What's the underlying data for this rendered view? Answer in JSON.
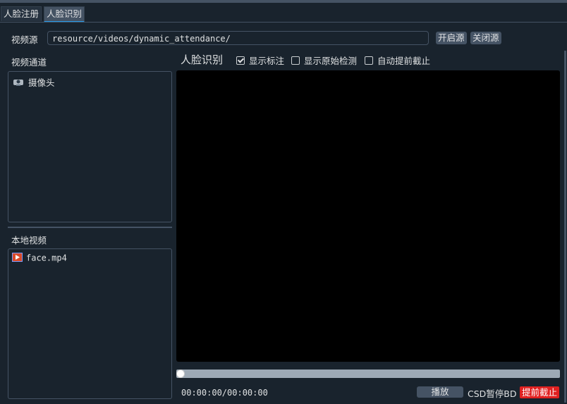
{
  "tabs": [
    {
      "label": "人脸注册",
      "active": false
    },
    {
      "label": "人脸识别",
      "active": true
    }
  ],
  "source": {
    "label": "视频源",
    "value": "resource/videos/dynamic_attendance/",
    "open_button": "开启源",
    "close_button": "关闭源"
  },
  "channels": {
    "title": "视频通道",
    "items": [
      {
        "label": "摄像头",
        "icon": "webcam-icon"
      }
    ]
  },
  "local_videos": {
    "title": "本地视频",
    "items": [
      {
        "label": "face.mp4",
        "icon": "video-file-icon"
      }
    ]
  },
  "recognition": {
    "title": "人脸识别",
    "options": [
      {
        "label": "显示标注",
        "checked": true
      },
      {
        "label": "显示原始检测",
        "checked": false
      },
      {
        "label": "自动提前截止",
        "checked": false
      }
    ]
  },
  "player": {
    "timecode": "00:00:00/00:00:00",
    "progress": 0,
    "play_button": "播放",
    "pause_overlap_text": "CSD暂停BD",
    "stop_button": "提前截止"
  },
  "colors": {
    "background": "#19232d",
    "accent": "#259ae9",
    "danger": "#e02020"
  }
}
